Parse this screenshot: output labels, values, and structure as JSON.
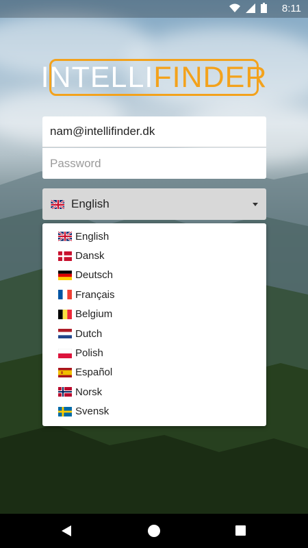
{
  "status_bar": {
    "time": "8:11",
    "icons": [
      "wifi-icon",
      "signal-icon",
      "battery-icon"
    ]
  },
  "logo": {
    "part1": "INTELLI",
    "part2": "FINDER",
    "accent_color": "#f3a21c"
  },
  "login": {
    "email_value": "nam@intellifinder.dk",
    "password_placeholder": "Password"
  },
  "language_select": {
    "selected": "English",
    "options": [
      {
        "label": "English",
        "flag": "uk-flag-icon"
      },
      {
        "label": "Dansk",
        "flag": "denmark-flag-icon"
      },
      {
        "label": "Deutsch",
        "flag": "germany-flag-icon"
      },
      {
        "label": "Français",
        "flag": "france-flag-icon"
      },
      {
        "label": "Belgium",
        "flag": "belgium-flag-icon"
      },
      {
        "label": "Dutch",
        "flag": "netherlands-flag-icon"
      },
      {
        "label": "Polish",
        "flag": "poland-flag-icon"
      },
      {
        "label": "Español",
        "flag": "spain-flag-icon"
      },
      {
        "label": "Norsk",
        "flag": "norway-flag-icon"
      },
      {
        "label": "Svensk",
        "flag": "sweden-flag-icon"
      }
    ]
  },
  "nav": {
    "icons": [
      "back-icon",
      "home-icon",
      "recents-icon"
    ]
  }
}
